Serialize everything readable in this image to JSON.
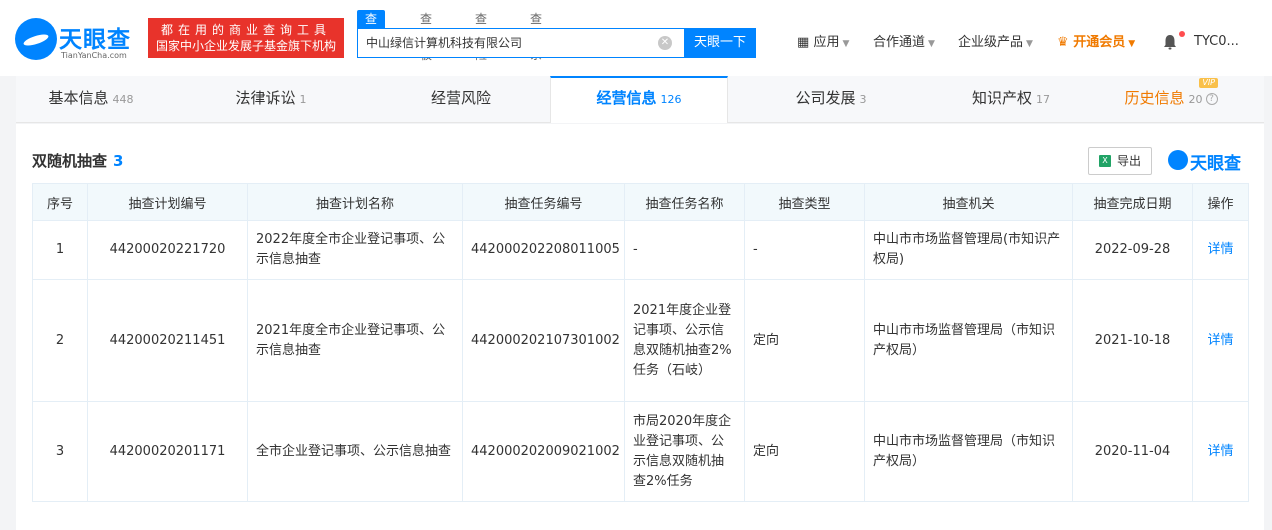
{
  "header": {
    "logo_text": "天眼查",
    "logo_sub": "TianYanCha.com",
    "promo_line1": "都在用的商业查询工具",
    "promo_line2": "国家中小企业发展子基金旗下机构",
    "search_tabs": [
      "查公司",
      "查老板",
      "查风险",
      "查关系"
    ],
    "search_value": "中山绿信计算机科技有限公司",
    "search_button": "天眼一下",
    "nav": {
      "apps": "应用",
      "channel": "合作通道",
      "enterprise": "企业级产品",
      "vip": "开通会员",
      "user": "TYC0..."
    }
  },
  "tabs": [
    {
      "label": "基本信息",
      "count": "448"
    },
    {
      "label": "法律诉讼",
      "count": "1"
    },
    {
      "label": "经营风险",
      "count": ""
    },
    {
      "label": "经营信息",
      "count": "126"
    },
    {
      "label": "公司发展",
      "count": "3"
    },
    {
      "label": "知识产权",
      "count": "17"
    },
    {
      "label": "历史信息",
      "count": "20"
    }
  ],
  "vip_badge": "VIP",
  "section": {
    "title": "双随机抽查",
    "count": "3",
    "export_label": "导出",
    "brand": "天眼查"
  },
  "table": {
    "headers": [
      "序号",
      "抽查计划编号",
      "抽查计划名称",
      "抽查任务编号",
      "抽查任务名称",
      "抽查类型",
      "抽查机关",
      "抽查完成日期",
      "操作"
    ],
    "rows": [
      {
        "idx": "1",
        "plan_no": "44200020221720",
        "plan_name": "2022年度全市企业登记事项、公示信息抽查",
        "task_no": "442000202208011005",
        "task_name": "-",
        "type": "-",
        "authority": "中山市市场监督管理局(市知识产权局)",
        "date": "2022-09-28",
        "action": "详情"
      },
      {
        "idx": "2",
        "plan_no": "44200020211451",
        "plan_name": "2021年度全市企业登记事项、公示信息抽查",
        "task_no": "442000202107301002",
        "task_name": "2021年度企业登记事项、公示信息双随机抽查2%任务（石岐）",
        "type": "定向",
        "authority": "中山市市场监督管理局（市知识产权局）",
        "date": "2021-10-18",
        "action": "详情"
      },
      {
        "idx": "3",
        "plan_no": "44200020201171",
        "plan_name": "全市企业登记事项、公示信息抽查",
        "task_no": "442000202009021002",
        "task_name": "市局2020年度企业登记事项、公示信息双随机抽查2%任务",
        "type": "定向",
        "authority": "中山市市场监督管理局（市知识产权局）",
        "date": "2020-11-04",
        "action": "详情"
      }
    ]
  }
}
